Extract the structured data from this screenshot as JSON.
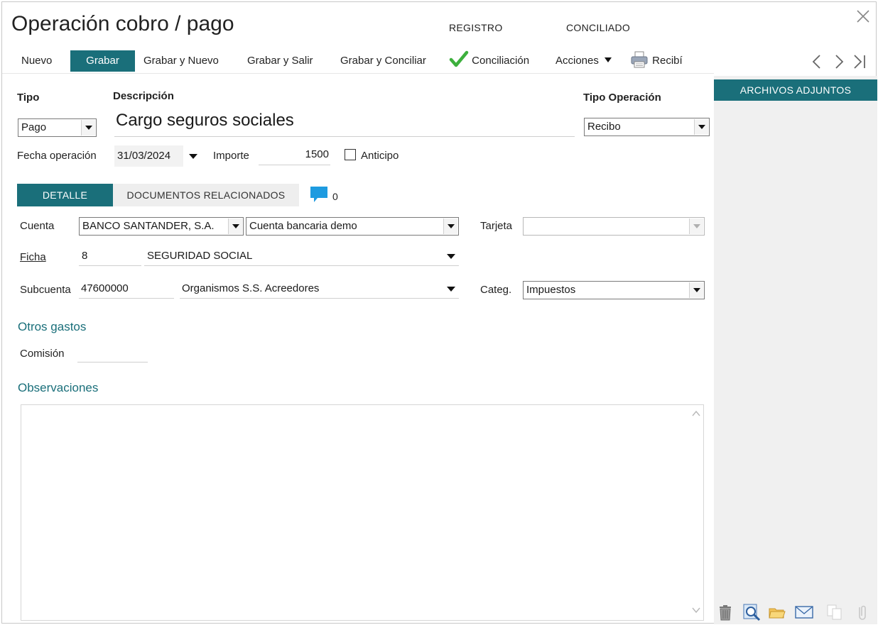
{
  "window": {
    "title": "Operación cobro / pago",
    "status_registro": "REGISTRO",
    "status_conciliado": "CONCILIADO"
  },
  "toolbar": {
    "nuevo": "Nuevo",
    "grabar": "Grabar",
    "grabar_nuevo": "Grabar y Nuevo",
    "grabar_salir": "Grabar y Salir",
    "grabar_conciliar": "Grabar y Conciliar",
    "conciliacion": "Conciliación",
    "acciones": "Acciones",
    "recibi": "Recibí"
  },
  "form": {
    "tipo_label": "Tipo",
    "tipo_value": "Pago",
    "descripcion_label": "Descripción",
    "descripcion_value": "Cargo seguros sociales",
    "tipo_operacion_label": "Tipo Operación",
    "tipo_operacion_value": "Recibo",
    "fecha_label": "Fecha operación",
    "fecha_value": "31/03/2024",
    "importe_label": "Importe",
    "importe_value": "1500",
    "anticipo_label": "Anticipo"
  },
  "tabs": {
    "detalle": "DETALLE",
    "documentos": "DOCUMENTOS RELACIONADOS",
    "comments_count": "0"
  },
  "detalle": {
    "cuenta_label": "Cuenta",
    "cuenta_banco": "BANCO SANTANDER, S.A.",
    "cuenta_nombre": "Cuenta bancaria demo",
    "tarjeta_label": "Tarjeta",
    "tarjeta_value": "",
    "ficha_label": "Ficha",
    "ficha_num": "8",
    "ficha_nombre": "SEGURIDAD SOCIAL",
    "subcuenta_label": "Subcuenta",
    "subcuenta_num": "47600000",
    "subcuenta_nombre": "Organismos S.S. Acreedores",
    "categ_label": "Categ.",
    "categ_value": "Impuestos",
    "otros_gastos": "Otros gastos",
    "comision_label": "Comisión",
    "comision_value": "",
    "observaciones": "Observaciones",
    "observaciones_value": ""
  },
  "sidebar": {
    "header": "ARCHIVOS ADJUNTOS",
    "icons": [
      "trash-icon",
      "preview-icon",
      "folder-icon",
      "email-icon",
      "copy-icon",
      "attach-icon"
    ]
  },
  "colors": {
    "accent": "#1a6f7a",
    "check": "#3db03d",
    "comment": "#1e9be0"
  }
}
